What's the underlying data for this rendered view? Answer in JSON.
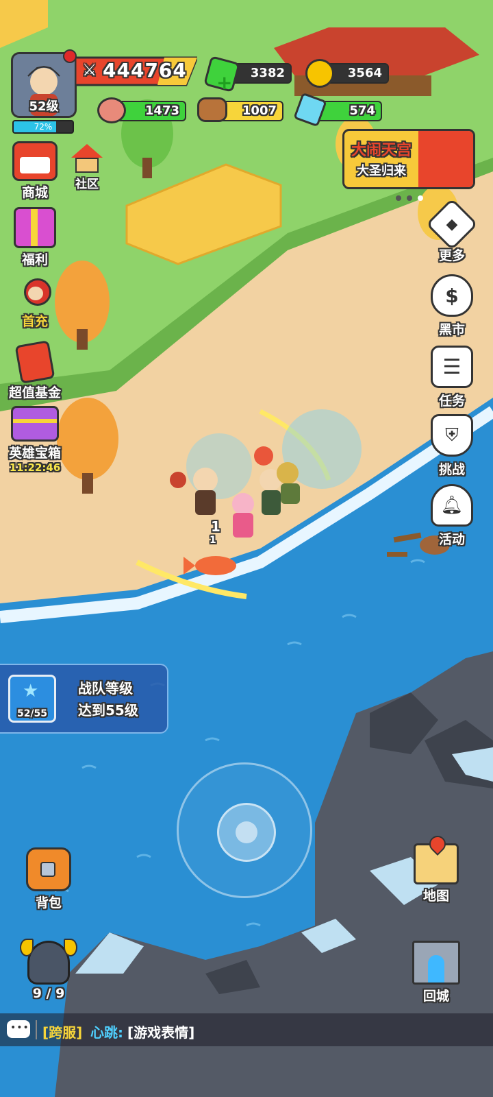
{
  "player": {
    "level_label": "52级",
    "exp_percent_label": "72%",
    "exp_fraction": 0.72,
    "power": "444764"
  },
  "resources": {
    "gem": "3382",
    "gold": "3564",
    "meat": "1473",
    "wood": "1007",
    "crystal": "574"
  },
  "event_banner": {
    "title": "大闹天宫",
    "subtitle": "大圣归来"
  },
  "left_menu": {
    "shop": "商城",
    "community": "社区",
    "welfare": "福利",
    "first_charge": "首充",
    "fund": "超值基金",
    "hero_chest": "英雄宝箱",
    "hero_chest_timer": "11:22:46"
  },
  "right_menu": {
    "more": "更多",
    "black_market": "黑市",
    "tasks": "任务",
    "challenge": "挑战",
    "activity": "活动"
  },
  "quest": {
    "progress": "52/55",
    "line1": "战队等级",
    "line2": "达到55级"
  },
  "battle": {
    "damage1": "1",
    "damage2": "1"
  },
  "bottom": {
    "bag": "背包",
    "squad": "9 / 9",
    "map": "地图",
    "return_city": "回城"
  },
  "chat": {
    "channel": "[跨服]",
    "sender": "心跳:",
    "message": "[游戏表情]"
  },
  "colors": {
    "grass": "#8fd36a",
    "sand": "#f2d2a2",
    "water": "#2a8fd3",
    "power_bar": "#e8452c",
    "green_bar": "#3fd23c",
    "yellow_bar": "#f7d53a",
    "exp_bar": "#2cc3e8"
  }
}
